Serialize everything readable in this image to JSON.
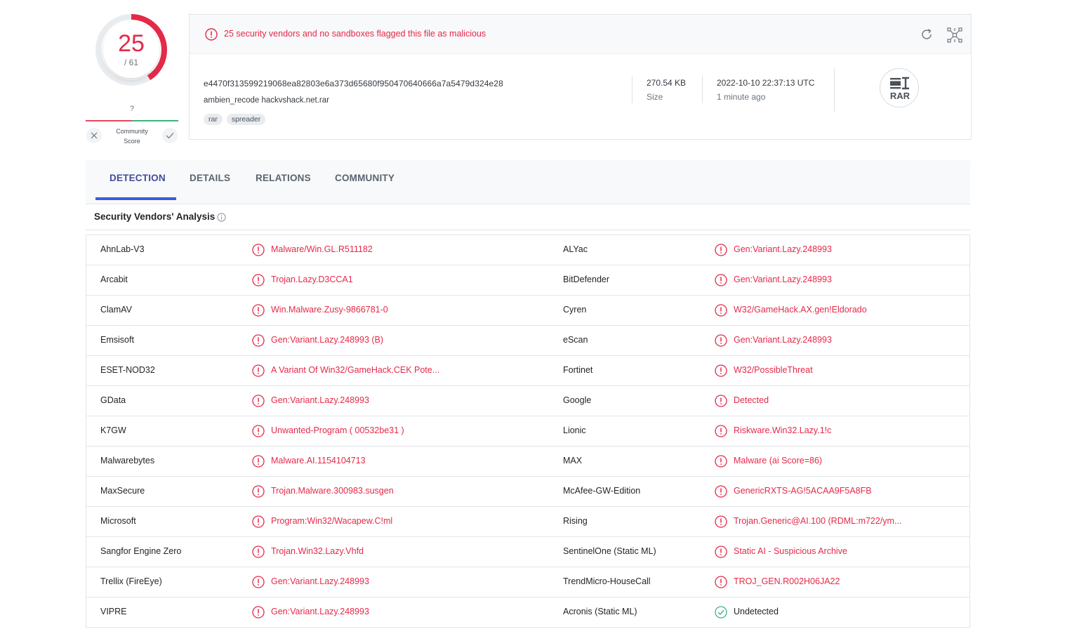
{
  "score": {
    "detections": "25",
    "total": "/ 61"
  },
  "community": {
    "question": "?",
    "label_line1": "Community",
    "label_line2": "Score"
  },
  "alert": {
    "text": "25 security vendors and no sandboxes flagged this file as malicious"
  },
  "file": {
    "hash": "e4470f313599219068ea82803e6a373d65680f950470640666a7a5479d324e28",
    "name": "ambien_recode hackvshack.net.rar",
    "tags": [
      "rar",
      "spreader"
    ],
    "size_value": "270.54 KB",
    "size_label": "Size",
    "date_value": "2022-10-10 22:37:13 UTC",
    "date_label": "1 minute ago",
    "type_label": "RAR"
  },
  "tabs": [
    "DETECTION",
    "DETAILS",
    "RELATIONS",
    "COMMUNITY"
  ],
  "section": {
    "title": "Security Vendors' Analysis"
  },
  "colors": {
    "malicious": "#e52949",
    "clean": "#3fb27f",
    "accent": "#3b5bdb"
  },
  "rows": [
    {
      "left": {
        "vendor": "AhnLab-V3",
        "result": "Malware/Win.GL.R511182",
        "status": "malicious"
      },
      "right": {
        "vendor": "ALYac",
        "result": "Gen:Variant.Lazy.248993",
        "status": "malicious"
      }
    },
    {
      "left": {
        "vendor": "Arcabit",
        "result": "Trojan.Lazy.D3CCA1",
        "status": "malicious"
      },
      "right": {
        "vendor": "BitDefender",
        "result": "Gen:Variant.Lazy.248993",
        "status": "malicious"
      }
    },
    {
      "left": {
        "vendor": "ClamAV",
        "result": "Win.Malware.Zusy-9866781-0",
        "status": "malicious"
      },
      "right": {
        "vendor": "Cyren",
        "result": "W32/GameHack.AX.gen!Eldorado",
        "status": "malicious"
      }
    },
    {
      "left": {
        "vendor": "Emsisoft",
        "result": "Gen:Variant.Lazy.248993 (B)",
        "status": "malicious"
      },
      "right": {
        "vendor": "eScan",
        "result": "Gen:Variant.Lazy.248993",
        "status": "malicious"
      }
    },
    {
      "left": {
        "vendor": "ESET-NOD32",
        "result": "A Variant Of Win32/GameHack.CEK Pote...",
        "status": "malicious"
      },
      "right": {
        "vendor": "Fortinet",
        "result": "W32/PossibleThreat",
        "status": "malicious"
      }
    },
    {
      "left": {
        "vendor": "GData",
        "result": "Gen:Variant.Lazy.248993",
        "status": "malicious"
      },
      "right": {
        "vendor": "Google",
        "result": "Detected",
        "status": "malicious"
      }
    },
    {
      "left": {
        "vendor": "K7GW",
        "result": "Unwanted-Program ( 00532be31 )",
        "status": "malicious"
      },
      "right": {
        "vendor": "Lionic",
        "result": "Riskware.Win32.Lazy.1!c",
        "status": "malicious"
      }
    },
    {
      "left": {
        "vendor": "Malwarebytes",
        "result": "Malware.AI.1154104713",
        "status": "malicious"
      },
      "right": {
        "vendor": "MAX",
        "result": "Malware (ai Score=86)",
        "status": "malicious"
      }
    },
    {
      "left": {
        "vendor": "MaxSecure",
        "result": "Trojan.Malware.300983.susgen",
        "status": "malicious"
      },
      "right": {
        "vendor": "McAfee-GW-Edition",
        "result": "GenericRXTS-AG!5ACAA9F5A8FB",
        "status": "malicious"
      }
    },
    {
      "left": {
        "vendor": "Microsoft",
        "result": "Program:Win32/Wacapew.C!ml",
        "status": "malicious"
      },
      "right": {
        "vendor": "Rising",
        "result": "Trojan.Generic@AI.100 (RDML:m722/ym...",
        "status": "malicious"
      }
    },
    {
      "left": {
        "vendor": "Sangfor Engine Zero",
        "result": "Trojan.Win32.Lazy.Vhfd",
        "status": "malicious"
      },
      "right": {
        "vendor": "SentinelOne (Static ML)",
        "result": "Static AI - Suspicious Archive",
        "status": "malicious"
      }
    },
    {
      "left": {
        "vendor": "Trellix (FireEye)",
        "result": "Gen:Variant.Lazy.248993",
        "status": "malicious"
      },
      "right": {
        "vendor": "TrendMicro-HouseCall",
        "result": "TROJ_GEN.R002H06JA22",
        "status": "malicious"
      }
    },
    {
      "left": {
        "vendor": "VIPRE",
        "result": "Gen:Variant.Lazy.248993",
        "status": "malicious"
      },
      "right": {
        "vendor": "Acronis (Static ML)",
        "result": "Undetected",
        "status": "clean"
      }
    }
  ]
}
